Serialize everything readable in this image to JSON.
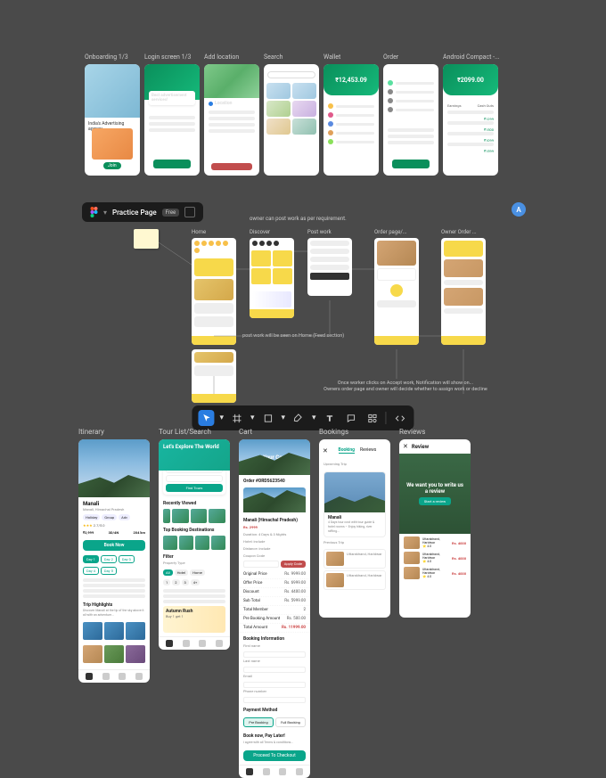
{
  "row1": {
    "labels": [
      "Onboarding 1/3",
      "Login screen 1/3",
      "Add location",
      "Search",
      "Wallet",
      "Order",
      "Android Compact -..."
    ],
    "onboarding_title": "India's Advertising agency",
    "login_title": "Best advertisement services!",
    "location_title": "Location",
    "wallet_amount": "₹12,453.09",
    "order_amount": "₹2099.00"
  },
  "toolbar": {
    "file_name": "Practice Page",
    "badge": "Free",
    "avatar_letter": "A"
  },
  "flow": {
    "note_top": "owner can post work as per requirement.",
    "labels": [
      "Home",
      "Discover",
      "Post work",
      "Order page/...",
      "Owner Order ..."
    ],
    "feed_note": "post work will be seen on Home (Feed section)",
    "bottom_note": "Once worker clicks on Accept work, Notification will show on...\nOwners order page and owner will decide whether to assign work or decline"
  },
  "travel": {
    "labels": [
      "Itinerary",
      "Tour List/Search",
      "Cart",
      "Bookings",
      "Reviews"
    ],
    "itinerary": {
      "title": "Manali",
      "sub": "Manali, Himachal Pradesh",
      "rating_text": "2.7/5.0",
      "stats": {
        "price": "₹2,999",
        "duration": "3D/4N",
        "distance": "204 km"
      },
      "cta": "Book Now",
      "days": [
        "Day 1",
        "Day 2",
        "Day 3",
        "Day 4",
        "Day 5"
      ],
      "highlights": "Trip Highlights",
      "desc": "Discover Manali at the tip of the sky above it all with an adventure..."
    },
    "tour": {
      "hero": "Let's Explore The World",
      "find": "Find Tours",
      "recently": "Recently Viewed",
      "topdest": "Top Booking Destinations",
      "filter": "Filter",
      "prop": "Property Type",
      "promo_title": "Autumn Rush",
      "promo_sub": "Buy 1 get 1"
    },
    "cart": {
      "hero": "Your Cart",
      "order_id": "Order #ORD5623540",
      "hotel": "Manali (Himachal Pradesh)",
      "price": "Rs. 2999",
      "dur": "Duration: 4 Days & 3 Nights",
      "hotel2": "Hotel: include",
      "dist": "Distance: include",
      "coupon": "Coupon Code",
      "apply": "Apply Code",
      "rows": [
        [
          "Original Price",
          "Rs. 9999.00"
        ],
        [
          "Offer Price",
          "Rs. 6999.00"
        ],
        [
          "Discount",
          "Rs. 4400.00"
        ],
        [
          "Sub Total",
          "Rs. 5999.00"
        ],
        [
          "Total Member",
          "2"
        ],
        [
          "Pre Booking Amount",
          "Rs. 500.00"
        ],
        [
          "Total Amount",
          "Rs. 11999.00"
        ]
      ],
      "booking_info": "Booking Information",
      "fields": [
        "First name",
        "Last name",
        "Email",
        "Phone number"
      ],
      "pay_method": "Payment Method",
      "pay_opts": [
        "Pre Booking",
        "Full Booking"
      ],
      "book_later": "Book now, Pay Later!",
      "terms": "I agree with all Terms & conditions...",
      "proceed": "Proceed To Checkout"
    },
    "bookings": {
      "tabs": [
        "Booking",
        "Reviews"
      ],
      "upcoming": "Upcoming Trip",
      "name": "Manali",
      "previous": "Previous Trip",
      "past": [
        "Uttarakhand, Haridwar",
        "Uttarakhand, Haridwar"
      ]
    },
    "reviews": {
      "title": "Review",
      "hero_text": "We want you to write us a review",
      "cta": "Start a review",
      "items": [
        "Uttarakhand, Haridwar",
        "Uttarakhand, Haridwar",
        "Uttarakhand, Haridwar"
      ],
      "price": "Rs. 4000"
    }
  }
}
